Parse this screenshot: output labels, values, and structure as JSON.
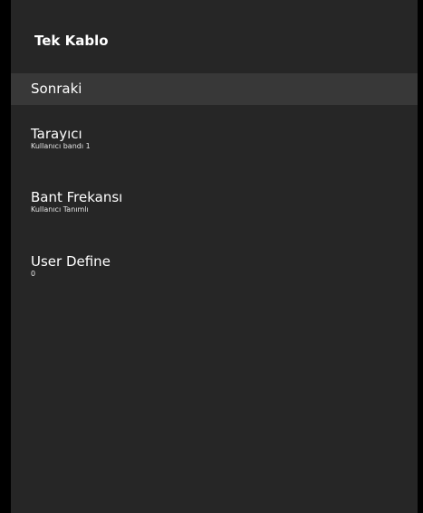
{
  "screen": {
    "title": "Tek Kablo"
  },
  "menu": {
    "items": [
      {
        "label": "Sonraki",
        "value": ""
      },
      {
        "label": "Tarayıcı",
        "value": "Kullanıcı bandı 1"
      },
      {
        "label": "Bant Frekansı",
        "value": "Kullanıcı Tanımlı"
      },
      {
        "label": "User Define",
        "value": "0"
      }
    ]
  },
  "colors": {
    "background": "#000000",
    "panel": "#262626",
    "selected_row": "#383838",
    "text": "#ffffff"
  }
}
